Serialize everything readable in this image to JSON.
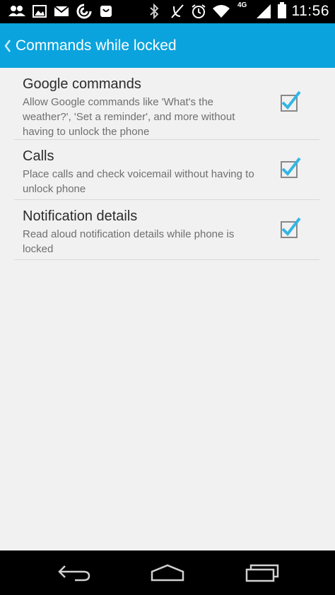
{
  "status_bar": {
    "time": "11:56",
    "network_type": "4G",
    "icons": [
      "contacts-notification-icon",
      "gallery-notification-icon",
      "gmail-notification-icon",
      "sync-notification-icon",
      "bag-notification-icon",
      "bluetooth-icon",
      "mute-icon",
      "alarm-icon",
      "wifi-icon",
      "signal-icon",
      "battery-icon"
    ]
  },
  "action_bar": {
    "title": "Commands while locked"
  },
  "preferences": [
    {
      "title": "Google commands",
      "summary": "Allow Google commands like 'What's the weather?', 'Set a reminder', and more without having to unlock the phone",
      "checked": true
    },
    {
      "title": "Calls",
      "summary": "Place calls and check voicemail without having to unlock phone",
      "checked": true
    },
    {
      "title": "Notification details",
      "summary": "Read aloud notification details while phone is locked",
      "checked": true
    }
  ],
  "colors": {
    "accent": "#0aa3dd",
    "check": "#33b5e5",
    "background": "#f1f1f1"
  },
  "nav_bar": {
    "buttons": [
      "back-icon",
      "home-icon",
      "recent-apps-icon"
    ]
  }
}
